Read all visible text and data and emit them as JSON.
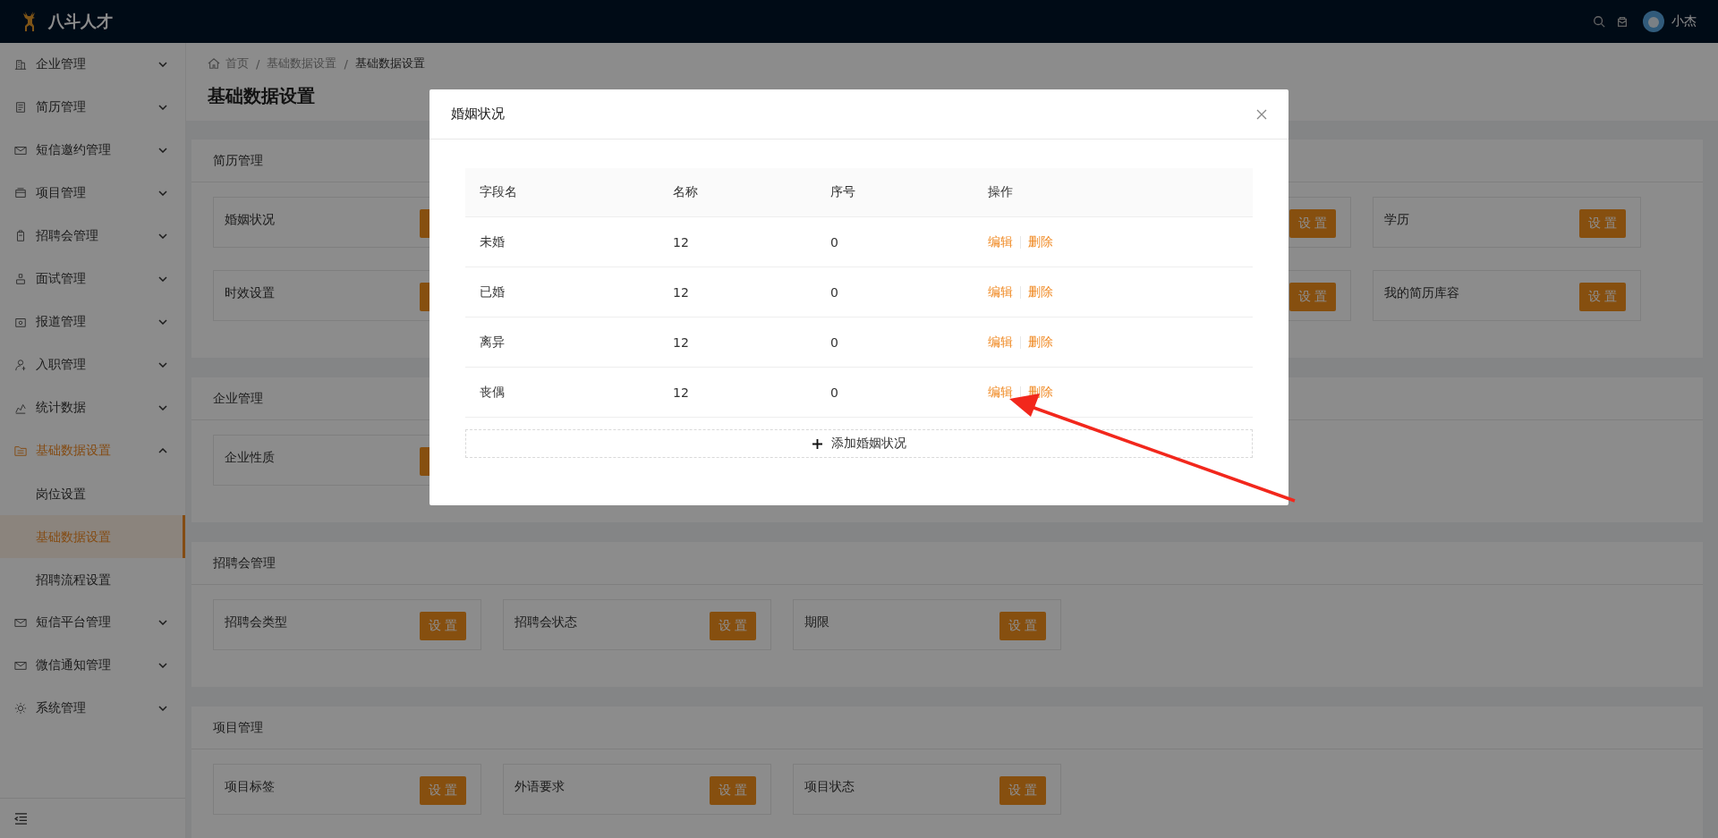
{
  "header": {
    "brand": "八斗人才",
    "user": "小杰"
  },
  "sidebar": {
    "items": [
      {
        "label": "企业管理",
        "expanded": false,
        "selected": false
      },
      {
        "label": "简历管理",
        "expanded": false,
        "selected": false
      },
      {
        "label": "短信邀约管理",
        "expanded": false,
        "selected": false
      },
      {
        "label": "项目管理",
        "expanded": false,
        "selected": false
      },
      {
        "label": "招聘会管理",
        "expanded": false,
        "selected": false
      },
      {
        "label": "面试管理",
        "expanded": false,
        "selected": false
      },
      {
        "label": "报道管理",
        "expanded": false,
        "selected": false
      },
      {
        "label": "入职管理",
        "expanded": false,
        "selected": false
      },
      {
        "label": "统计数据",
        "expanded": false,
        "selected": false
      },
      {
        "label": "基础数据设置",
        "expanded": true,
        "selected": true,
        "children": [
          {
            "label": "岗位设置",
            "selected": false
          },
          {
            "label": "基础数据设置",
            "selected": true
          },
          {
            "label": "招聘流程设置",
            "selected": false
          }
        ]
      },
      {
        "label": "短信平台管理",
        "expanded": false,
        "selected": false
      },
      {
        "label": "微信通知管理",
        "expanded": false,
        "selected": false
      },
      {
        "label": "系统管理",
        "expanded": false,
        "selected": false
      }
    ]
  },
  "breadcrumb": [
    "首页",
    "基础数据设置",
    "基础数据设置"
  ],
  "breadcrumb_separator": "/",
  "page_title": "基础数据设置",
  "sections": [
    {
      "title": "简历管理",
      "rows": [
        [
          {
            "label": "婚姻状况",
            "covered_button": true
          },
          {},
          {},
          {
            "button": "设置"
          },
          {
            "label": "学历",
            "button": "设置"
          }
        ],
        [
          {
            "label": "时效设置",
            "covered_button": true
          },
          {},
          {},
          {
            "button": "设置"
          },
          {
            "label": "我的简历库容",
            "button": "设置"
          }
        ]
      ]
    },
    {
      "title": "企业管理",
      "rows": [
        [
          {
            "label": "企业性质",
            "covered_button": true
          }
        ]
      ]
    },
    {
      "title": "招聘会管理",
      "rows": [
        [
          {
            "label": "招聘会类型",
            "button": "设置"
          },
          {
            "label": "招聘会状态",
            "button": "设置"
          },
          {
            "label": "期限",
            "button": "设置"
          }
        ]
      ]
    },
    {
      "title": "项目管理",
      "rows": [
        [
          {
            "label": "项目标签",
            "button": "设置"
          },
          {
            "label": "外语要求",
            "button": "设置"
          },
          {
            "label": "项目状态",
            "button": "设置"
          }
        ]
      ]
    }
  ],
  "modal": {
    "title": "婚姻状况",
    "columns": [
      "字段名",
      "名称",
      "序号",
      "操作"
    ],
    "rows": [
      {
        "field": "未婚",
        "name": "12",
        "order": "0",
        "actions": [
          "编辑",
          "删除"
        ]
      },
      {
        "field": "已婚",
        "name": "12",
        "order": "0",
        "actions": [
          "编辑",
          "删除"
        ]
      },
      {
        "field": "离异",
        "name": "12",
        "order": "0",
        "actions": [
          "编辑",
          "删除"
        ]
      },
      {
        "field": "丧偶",
        "name": "12",
        "order": "0",
        "actions": [
          "编辑",
          "删除"
        ]
      }
    ],
    "add_button": "添加婚姻状况"
  }
}
